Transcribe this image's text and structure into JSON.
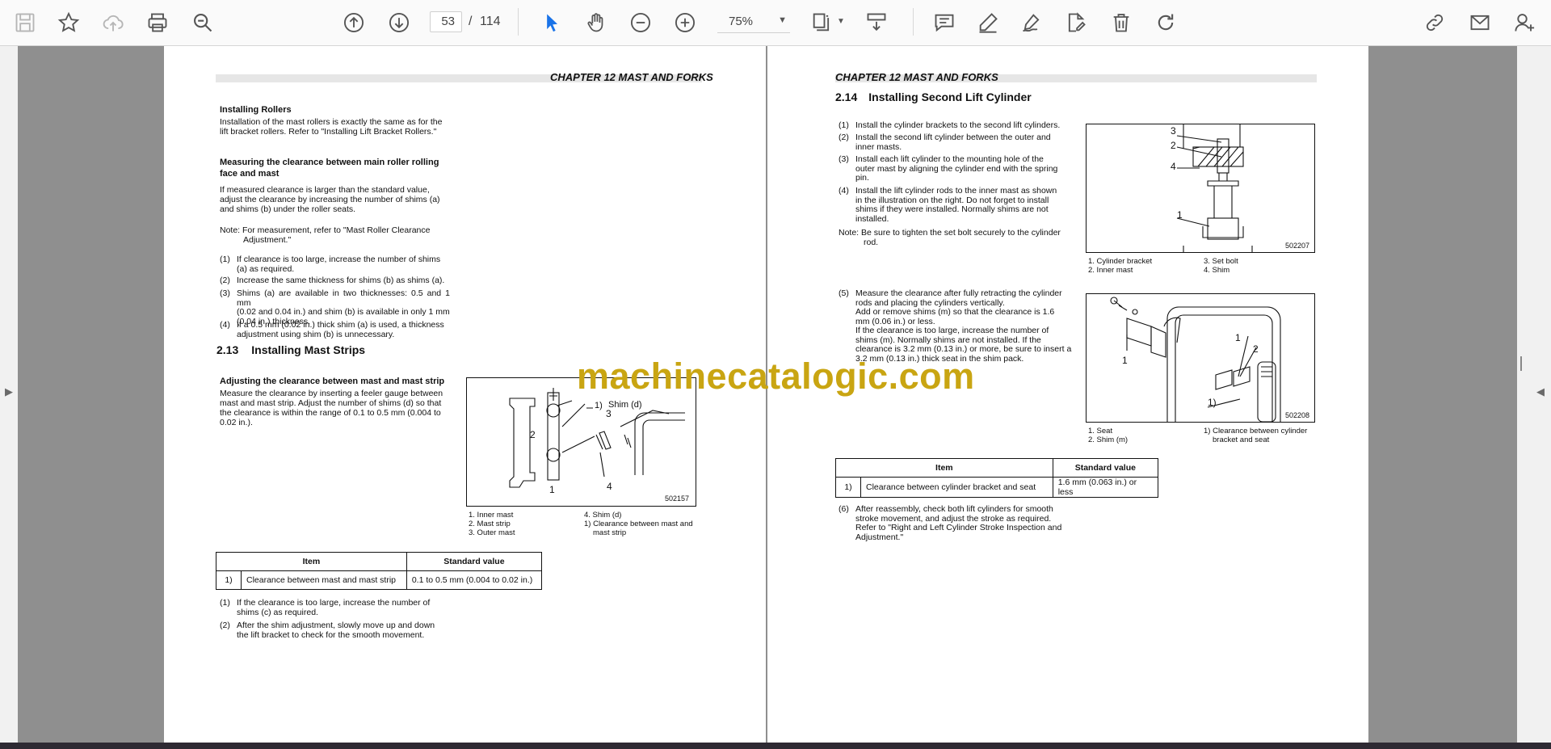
{
  "toolbar": {
    "page_current": "53",
    "page_separator": "/",
    "page_total": "114",
    "zoom": "75%",
    "icons": [
      "save-icon",
      "bookmark-star-icon",
      "upload-cloud-icon",
      "print-icon",
      "zoom-search-icon",
      "page-up-icon",
      "page-down-icon",
      "select-cursor-icon",
      "hand-pan-icon",
      "zoom-out-icon",
      "zoom-in-icon",
      "fit-page-icon",
      "scroll-mode-icon",
      "comment-icon",
      "highlight-pen-icon",
      "sign-icon",
      "edit-document-icon",
      "delete-trash-icon",
      "rotate-icon",
      "link-icon",
      "mail-icon",
      "user-add-icon"
    ]
  },
  "left_page": {
    "header": "CHAPTER 12 MAST AND FORKS",
    "installing_rollers_title": "Installing Rollers",
    "installing_rollers_text": [
      "Installation of the mast rollers is exactly the same as for the",
      "lift bracket rollers. Refer to \"Installing Lift Bracket Rollers.\""
    ],
    "measuring_title": [
      "Measuring the clearance between main roller rolling",
      "face and mast"
    ],
    "measuring_text": [
      "If measured clearance is larger than the standard value,",
      "adjust the clearance by increasing the number of shims (a)",
      "and shims (b) under the roller seats."
    ],
    "note": [
      "Note: For measurement, refer to \"Mast Roller Clearance",
      "Adjustment.\""
    ],
    "steps": [
      {
        "num": "(1)",
        "lines": [
          "If clearance is too large, increase the number of shims",
          "(a) as required."
        ]
      },
      {
        "num": "(2)",
        "lines": [
          "Increase the same thickness for shims (b) as shims (a)."
        ]
      },
      {
        "num": "(3)",
        "lines": [
          "Shims (a) are available in two thicknesses: 0.5 and 1 mm",
          "(0.02 and 0.04 in.) and shim (b) is available in only 1 mm",
          "(0.04 in.) thickness."
        ]
      },
      {
        "num": "(4)",
        "lines": [
          "If a 0.5 mm (0.02 in.) thick shim (a) is used, a thickness",
          "adjustment using shim (b) is unnecessary."
        ]
      }
    ],
    "section_number": "2.13",
    "section_title": "Installing Mast Strips",
    "adjusting_title": "Adjusting the clearance between mast and mast strip",
    "adjusting_text": [
      "Measure the clearance by inserting a feeler gauge between",
      "mast and mast strip. Adjust the number of shims (d) so that",
      "the clearance is within the range of 0.1 to 0.5 mm (0.004 to",
      "0.02 in.)."
    ],
    "figure_code": "502157",
    "figure_callouts": [
      "1)",
      "Shim (d)",
      "3",
      "2",
      "4",
      "1"
    ],
    "figure_caption_left": [
      "1. Inner mast",
      "2. Mast strip",
      "3. Outer mast"
    ],
    "figure_caption_right": [
      "4.  Shim (d)",
      "1) Clearance between mast and",
      "mast strip"
    ],
    "table": {
      "headers": [
        "Item",
        "Standard value"
      ],
      "rows": [
        [
          "1)",
          "Clearance between mast and mast strip",
          "0.1 to 0.5 mm (0.004 to 0.02 in.)"
        ]
      ]
    },
    "post_steps": [
      {
        "num": "(1)",
        "lines": [
          "If the clearance is too large, increase the number of",
          "shims (c) as required."
        ]
      },
      {
        "num": "(2)",
        "lines": [
          "After the shim adjustment, slowly move up and down",
          "the lift bracket to check for the smooth movement."
        ]
      }
    ]
  },
  "right_page": {
    "header": "CHAPTER 12 MAST AND FORKS",
    "section_number": "2.14",
    "section_title": "Installing Second Lift Cylinder",
    "steps": [
      {
        "num": "(1)",
        "lines": [
          "Install the cylinder brackets to the second lift cylinders."
        ]
      },
      {
        "num": "(2)",
        "lines": [
          "Install the second lift cylinder between the outer and",
          "inner masts."
        ]
      },
      {
        "num": "(3)",
        "lines": [
          "Install each lift cylinder to the mounting hole of the",
          "outer mast by aligning the cylinder end with the spring",
          "pin."
        ]
      },
      {
        "num": "(4)",
        "lines": [
          "Install the lift cylinder rods to the inner mast as shown",
          "in the illustration on the right. Do not forget to install",
          "shims if they were installed. Normally shims are not",
          "installed."
        ]
      }
    ],
    "note": [
      "Note: Be sure to tighten the set bolt securely to the cylinder",
      "rod."
    ],
    "figure1_code": "502207",
    "figure1_callouts": [
      "3",
      "2",
      "4",
      "1"
    ],
    "figure1_caption_left": [
      "1. Cylinder bracket",
      "2. Inner mast"
    ],
    "figure1_caption_right": [
      "3.  Set bolt",
      "4.  Shim"
    ],
    "step5": {
      "num": "(5)",
      "lines": [
        "Measure the clearance after fully retracting the cylinder",
        "rods and placing the cylinders vertically.",
        "Add or remove shims (m) so that the clearance is 1.6",
        "mm (0.06 in.) or less.",
        "If the clearance is too large, increase the number of",
        "shims (m). Normally shims are not installed. If the",
        "clearance is 3.2 mm (0.13 in.) or more, be sure to insert a",
        "3.2 mm (0.13 in.) thick seat in the shim pack."
      ]
    },
    "figure2_code": "502208",
    "figure2_callouts": [
      "1",
      "1",
      "2",
      "1)"
    ],
    "figure2_caption_left": [
      "1. Seat",
      "2. Shim (m)"
    ],
    "figure2_caption_right": [
      "1) Clearance between cylinder",
      "bracket and seat"
    ],
    "table": {
      "headers": [
        "Item",
        "Standard value"
      ],
      "rows": [
        [
          "1)",
          "Clearance between cylinder bracket and seat",
          "1.6 mm (0.063 in.) or less"
        ]
      ]
    },
    "step6": {
      "num": "(6)",
      "lines": [
        "After reassembly, check both lift cylinders for smooth",
        "stroke movement, and adjust the stroke as required.",
        "Refer to \"Right and Left Cylinder Stroke Inspection and",
        "Adjustment.\""
      ]
    }
  },
  "watermark": "machinecatalogic.com",
  "colors": {
    "toolbar_bg": "#fafafa",
    "viewer_bg": "#8f8f8f",
    "select_tool": "#1a73e8",
    "watermark": "#c9a512"
  }
}
